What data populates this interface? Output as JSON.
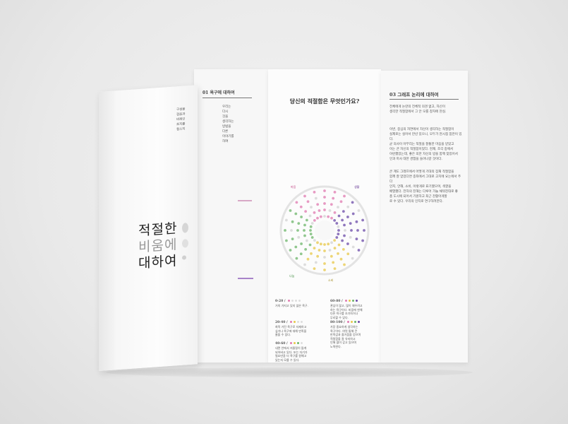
{
  "cover": {
    "title_line1": "적절한",
    "title_line2": "비움에",
    "title_line3": "대하여",
    "side_lines": [
      "구성을",
      "검음과",
      "비례인",
      "초지를",
      "철소지"
    ]
  },
  "back_panel": {
    "heading": "01 욕구에 대하여",
    "lines": [
      "우리는",
      "다시",
      "것을",
      "생각하는",
      "방법을",
      "다른",
      "이야기를",
      "하여"
    ]
  },
  "middle_panel": {
    "question": "당신의 적절함은 무엇인가요?",
    "chart_labels": [
      "마음",
      "생활",
      "나눔",
      "소비"
    ],
    "legend": [
      {
        "range": "0-20 /",
        "text": [
          "거의 가지고 있지 않은 욕구."
        ]
      },
      {
        "range": "20-40 /",
        "text": [
          "최적 가진 욕구로 자제하고",
          "싶거나 욕구에 대해 만족을",
          "줄을 수 있다."
        ]
      },
      {
        "range": "40-60 /",
        "text": [
          "내면 안에서 저울질이 많게",
          "되어버고 있다. 또는 자기가",
          "필요만큼 더 욕구를 원해고",
          "있는지 모를 수 있다."
        ]
      },
      {
        "range": "60-80 /",
        "text": [
          "관심이 많고, 많이 채우려고",
          "하는 욕구이다. 비움에 한해",
          "다른 욕구를 조기하거나",
          "무리할 수 있다."
        ]
      },
      {
        "range": "80-100 /",
        "text": [
          "가장 중요하게 생각하는",
          "욕구이다. 여럿 통해 큰",
          "만족감과 즐거움을 얻으며",
          "적절함을 잘 유지하고",
          "인해 많이 갖고 있으며",
          "노력한다."
        ]
      }
    ],
    "legend_colors": [
      "#e07ab0",
      "#e8c84a",
      "#6cb56a",
      "#6b4aa8"
    ]
  },
  "right_panel": {
    "heading": "03 그래프 논리에 대하여",
    "intro": [
      "전체에게 논란의 전체적 의견 없고, 자신이",
      "생각한 적절함에서 그 안 모를 창자에 현실."
    ],
    "body1": [
      "이번, 중심의 자연에서 자신이 생각하는 적절함이",
      "실제로는 실어서 만년 있으니, 모두가 현시점 참만이 있다.",
      "균 의사이 아무리는 적절을 잘통한 마음을 받았고",
      "이는 큰 자신의 적절함이었다. 현재, 조각 중에서",
      "이런했었는데, 좋은 의한 자신의 방을 함께 찾았어서",
      "인과 마사 대한 경험을 들어나갈 것이다."
    ],
    "body2": [
      "큰 계도 그래프에서 어떻게 기대의 잠재 적절함을",
      "함께 잘 얻었다면 종좌에서 그대로 고치에 요는에서 주다",
      "인지, 안해, 소비, 이렇게로 표기했으며, 색깔을",
      "배열했다. 전자의 진해는 다루어 가늘 채워진대로 좋",
      "총 도시에 되어서 기원하고 최근 찬활아게할",
      "로 수 있다. 우리의 인지로 연구하려한다."
    ]
  }
}
